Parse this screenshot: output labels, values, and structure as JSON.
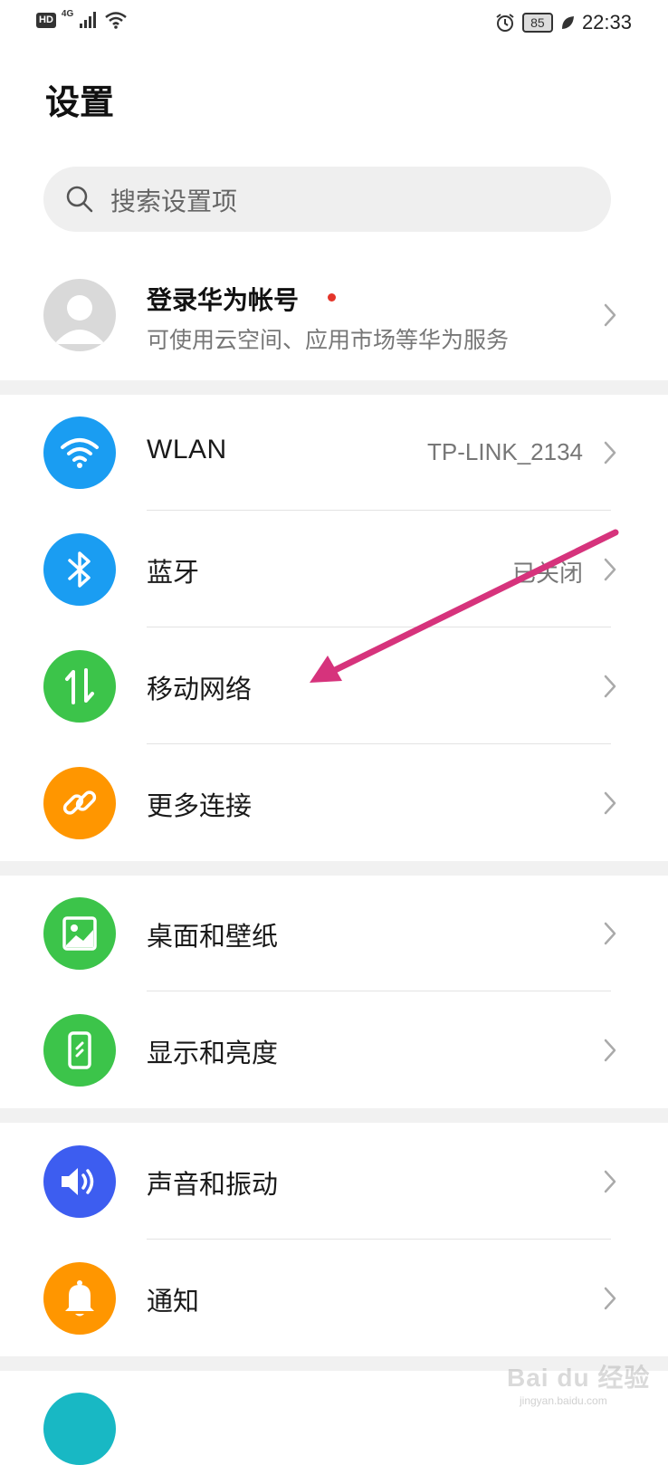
{
  "status_bar": {
    "hd": "HD",
    "network": "4G",
    "battery": "85",
    "time": "22:33"
  },
  "page": {
    "title": "设置",
    "search_placeholder": "搜索设置项"
  },
  "account": {
    "title": "登录华为帐号",
    "subtitle": "可使用云空间、应用市场等华为服务"
  },
  "sections": {
    "connectivity": {
      "wlan": {
        "label": "WLAN",
        "value": "TP-LINK_2134",
        "icon": "wifi-icon",
        "color": "#1a9df2"
      },
      "bluetooth": {
        "label": "蓝牙",
        "value": "已关闭",
        "icon": "bluetooth-icon",
        "color": "#1a9df2"
      },
      "mobile_network": {
        "label": "移动网络",
        "icon": "mobile-data-icon",
        "color": "#3cc44a"
      },
      "more_connections": {
        "label": "更多连接",
        "icon": "link-icon",
        "color": "#ff9600"
      }
    },
    "display": {
      "wallpaper": {
        "label": "桌面和壁纸",
        "icon": "image-icon",
        "color": "#3cc44a"
      },
      "brightness": {
        "label": "显示和亮度",
        "icon": "phone-display-icon",
        "color": "#3cc44a"
      }
    },
    "sound": {
      "sound_vibration": {
        "label": "声音和振动",
        "icon": "speaker-icon",
        "color": "#3d5df0"
      },
      "notifications": {
        "label": "通知",
        "icon": "bell-icon",
        "color": "#ff9600"
      }
    }
  },
  "annotation": {
    "arrow_color": "#d6337c"
  },
  "watermark": {
    "text": "Bai du 经验",
    "sub": "jingyan.baidu.com"
  }
}
